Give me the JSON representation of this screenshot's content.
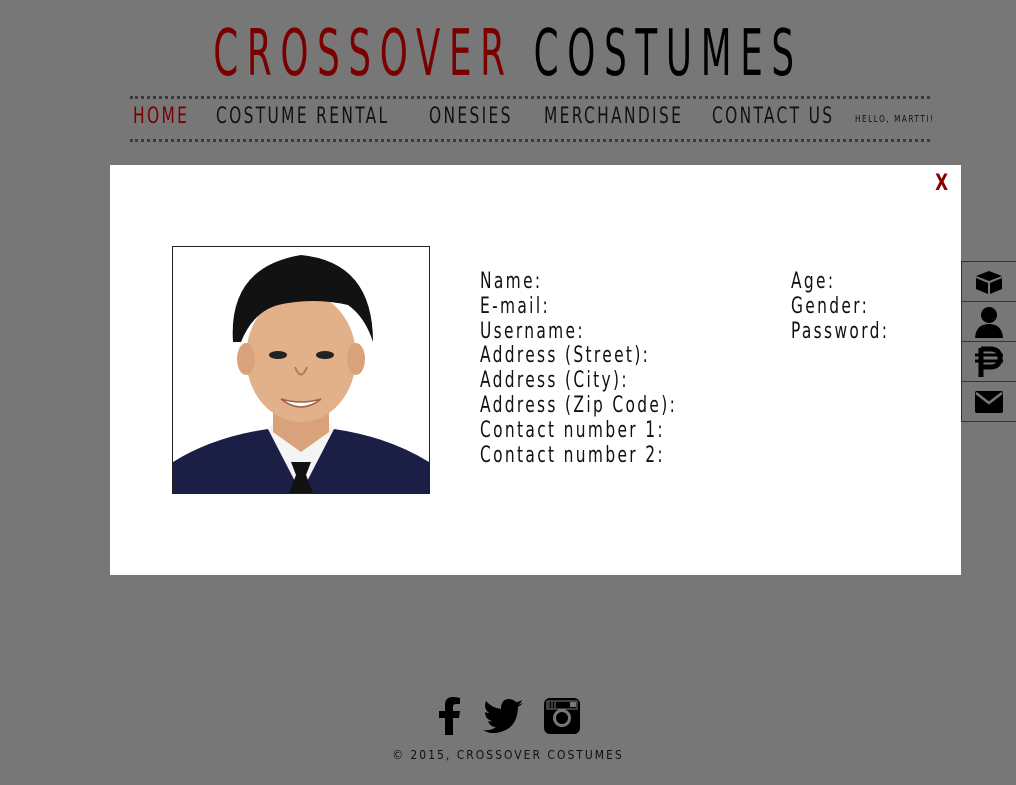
{
  "header": {
    "title_part1": "CROSSOVER",
    "title_part2": "COSTUMES"
  },
  "nav": {
    "items": [
      {
        "label": "HOME",
        "active": true
      },
      {
        "label": "COSTUME RENTAL"
      },
      {
        "label": "ONESIES"
      },
      {
        "label": "MERCHANDISE"
      },
      {
        "label": "CONTACT US"
      }
    ],
    "greeting": "HELLO, MARTTI!"
  },
  "modal": {
    "close_label": "X",
    "left_fields": [
      "Name:",
      "E-mail:",
      "Username:",
      "Address (Street):",
      "Address (City):",
      "Address (Zip Code):",
      "Contact number 1:",
      "Contact number 2:"
    ],
    "right_fields": [
      "Age:",
      "Gender:",
      "Password:"
    ]
  },
  "sidebar": {
    "icons": [
      "box-icon",
      "user-icon",
      "peso-icon",
      "mail-icon"
    ]
  },
  "social": {
    "icons": [
      "facebook-icon",
      "twitter-icon",
      "instagram-icon"
    ]
  },
  "footer": {
    "copyright": "© 2015, CROSSOVER COSTUMES"
  },
  "colors": {
    "background": "#777777",
    "accent": "#7a0000"
  }
}
